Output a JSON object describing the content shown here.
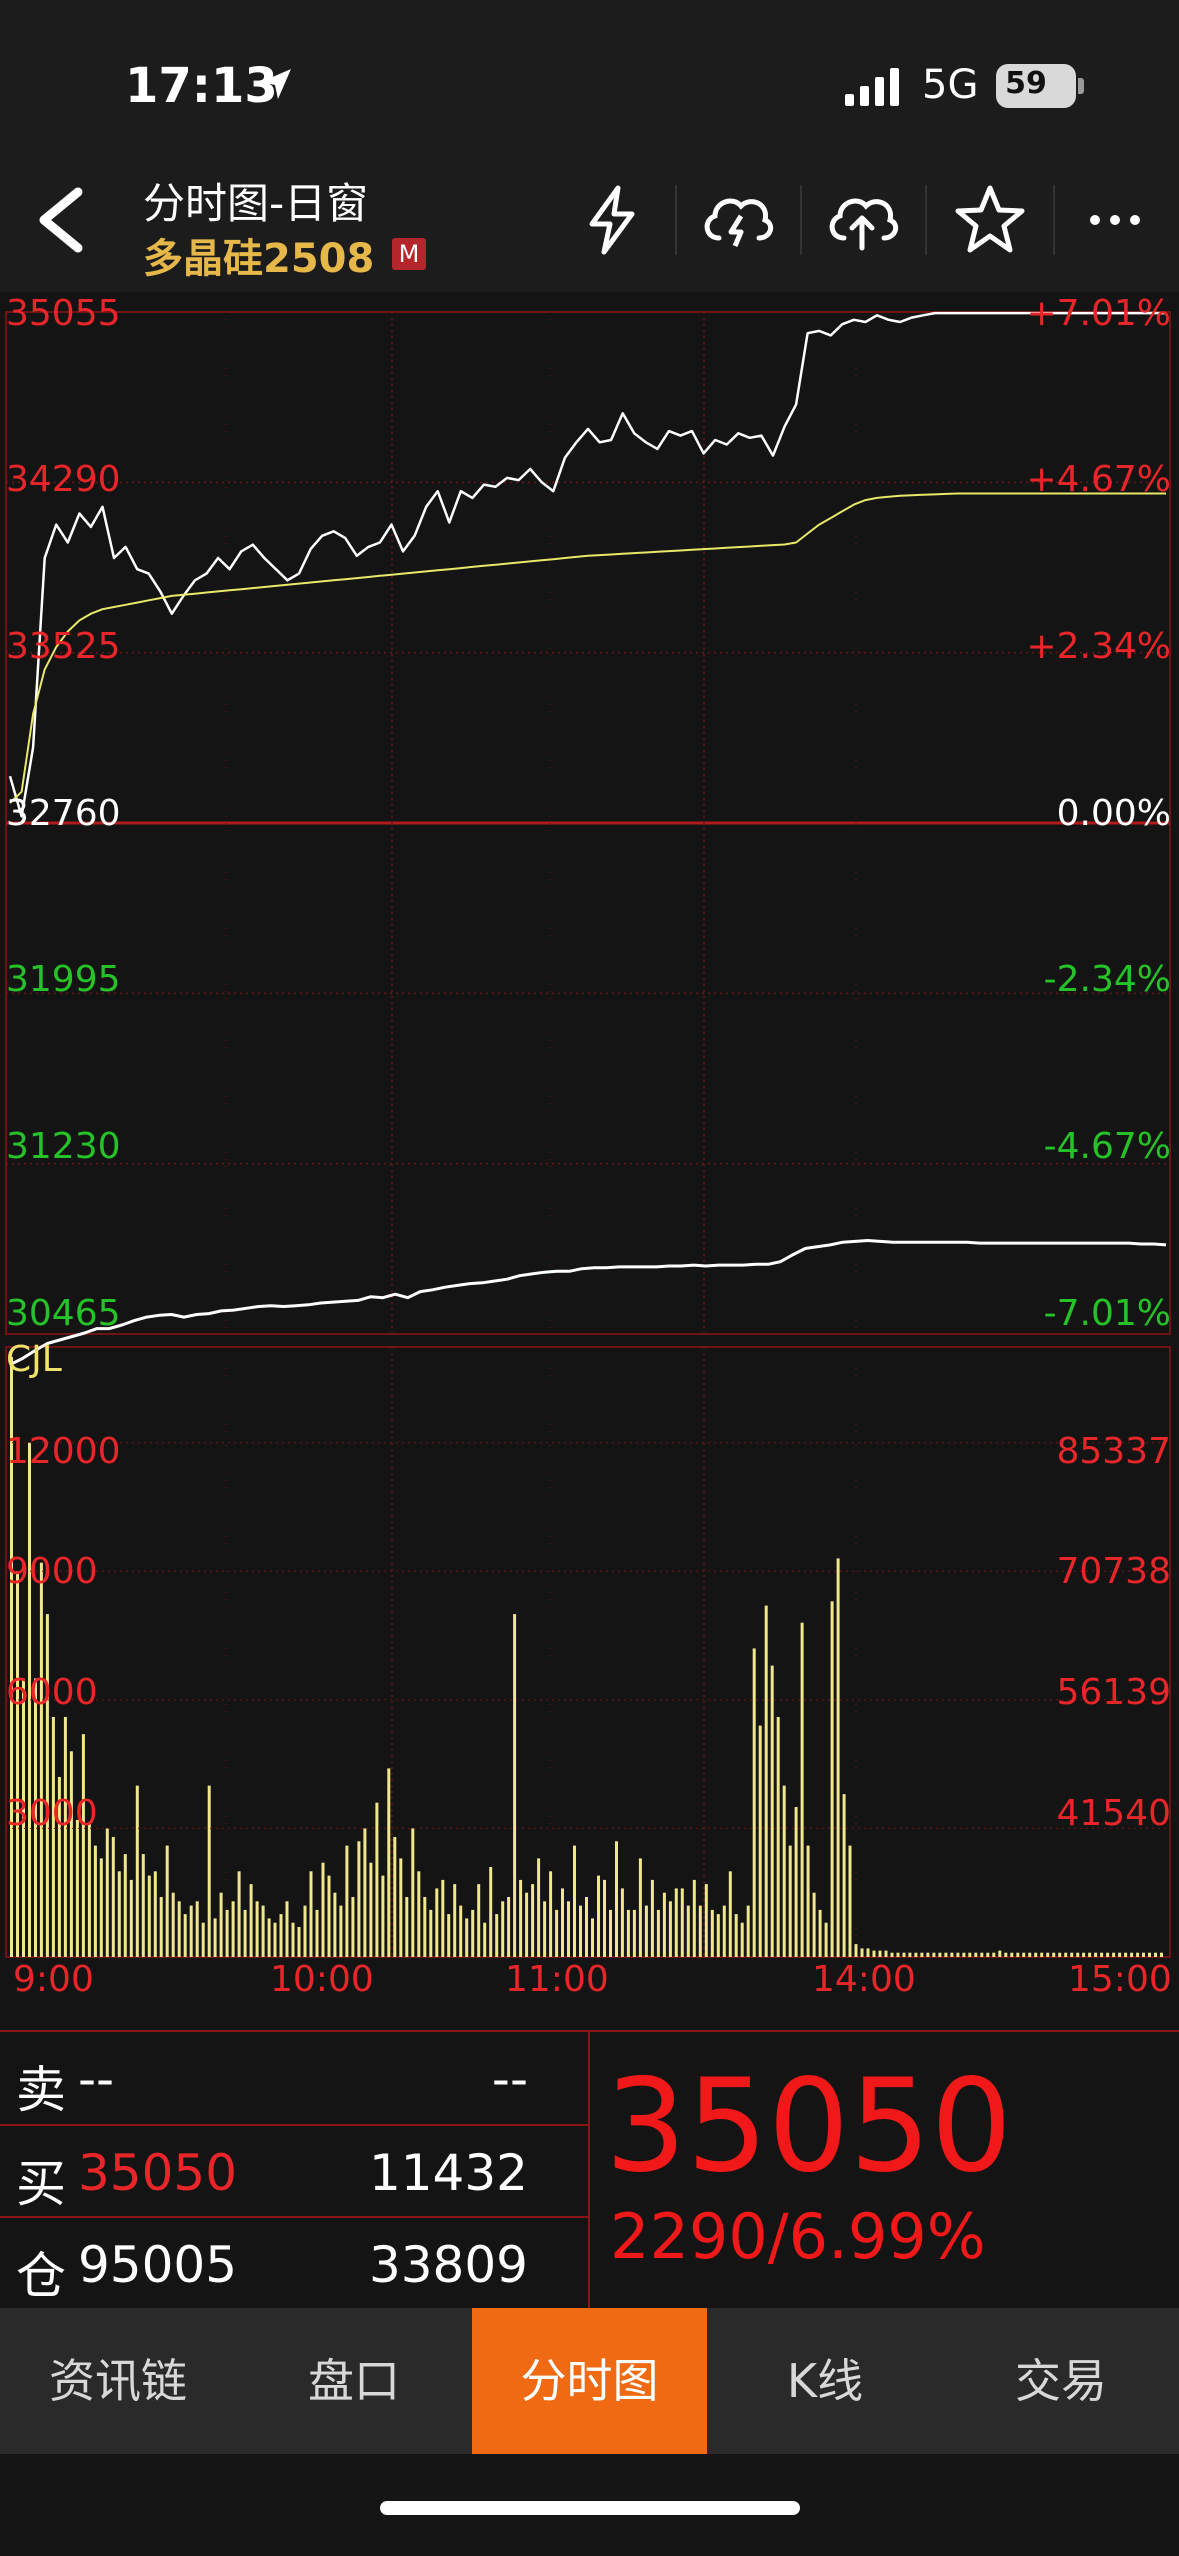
{
  "status_bar": {
    "time": "17:13",
    "network": "5G",
    "battery": "59"
  },
  "header": {
    "title": "分时图-日窗",
    "contract": "多晶硅2508",
    "badge": "M",
    "icons": [
      "back-icon",
      "lightning-icon",
      "cloud-lightning-icon",
      "cloud-upload-icon",
      "star-icon",
      "more-icon"
    ]
  },
  "price_axis": {
    "left": [
      "35055",
      "34290",
      "33525",
      "32760",
      "31995",
      "31230",
      "30465"
    ],
    "right": [
      "+7.01%",
      "+4.67%",
      "+2.34%",
      "0.00%",
      "-2.34%",
      "-4.67%",
      "-7.01%"
    ]
  },
  "volume_axis": {
    "title": "CJL",
    "left": [
      "12000",
      "9000",
      "6000",
      "3000"
    ],
    "right": [
      "85337",
      "70738",
      "56139",
      "41540"
    ]
  },
  "time_axis": [
    "9:00",
    "10:00",
    "11:00",
    "14:00",
    "15:00"
  ],
  "chart_data": [
    {
      "type": "line",
      "title": "",
      "ylim": [
        30465,
        35055
      ],
      "base": 32760,
      "series": [
        {
          "name": "price",
          "color": "#ffffff",
          "values": [
            32970,
            32790,
            33100,
            33950,
            34100,
            34020,
            34150,
            34090,
            34180,
            33950,
            34000,
            33900,
            33880,
            33800,
            33700,
            33780,
            33850,
            33880,
            33950,
            33900,
            33980,
            34010,
            33950,
            33900,
            33850,
            33880,
            33990,
            34050,
            34070,
            34040,
            33960,
            34000,
            34020,
            34100,
            33980,
            34050,
            34180,
            34250,
            34110,
            34250,
            34220,
            34280,
            34270,
            34310,
            34300,
            34350,
            34290,
            34250,
            34400,
            34470,
            34530,
            34470,
            34480,
            34600,
            34510,
            34470,
            34440,
            34520,
            34500,
            34520,
            34420,
            34480,
            34460,
            34510,
            34490,
            34500,
            34410,
            34540,
            34640,
            34960,
            34970,
            34950,
            35000,
            35020,
            35010,
            35040,
            35020,
            35010,
            35030,
            35040,
            35050,
            35050,
            35050,
            35050,
            35050,
            35050,
            35050,
            35050,
            35050,
            35050,
            35050,
            35050,
            35050,
            35050,
            35050,
            35050,
            35050,
            35050,
            35050,
            35050,
            35050
          ]
        },
        {
          "name": "average",
          "color": "#e8e86a",
          "values": [
            32850,
            32900,
            33250,
            33450,
            33550,
            33620,
            33670,
            33700,
            33720,
            33730,
            33740,
            33750,
            33760,
            33770,
            33780,
            33785,
            33790,
            33795,
            33800,
            33805,
            33810,
            33815,
            33820,
            33825,
            33830,
            33835,
            33840,
            33845,
            33850,
            33855,
            33860,
            33865,
            33870,
            33875,
            33880,
            33885,
            33890,
            33895,
            33900,
            33905,
            33910,
            33915,
            33920,
            33925,
            33930,
            33935,
            33940,
            33945,
            33950,
            33955,
            33960,
            33963,
            33966,
            33969,
            33972,
            33975,
            33978,
            33981,
            33984,
            33987,
            33990,
            33993,
            33996,
            33999,
            34002,
            34005,
            34008,
            34011,
            34020,
            34060,
            34100,
            34130,
            34160,
            34190,
            34210,
            34220,
            34225,
            34230,
            34232,
            34234,
            34236,
            34238,
            34240,
            34240,
            34240,
            34240,
            34240,
            34240,
            34240,
            34240,
            34240,
            34240,
            34240,
            34240,
            34240,
            34240,
            34240,
            34240,
            34240,
            34240,
            34240
          ]
        }
      ]
    },
    {
      "type": "bar",
      "title": "CJL",
      "ylim": [
        0,
        14000
      ],
      "series": [
        {
          "name": "volume",
          "color": "#f0e68c",
          "values": [
            14000,
            9000,
            6500,
            12000,
            6500,
            9200,
            8000,
            5600,
            4200,
            5600,
            4800,
            3200,
            5200,
            3100,
            2600,
            2300,
            3000,
            2800,
            2000,
            2400,
            1800,
            4000,
            2400,
            1900,
            2000,
            1400,
            2600,
            1500,
            1300,
            1000,
            1200,
            1300,
            800,
            4000,
            900,
            1500,
            1100,
            1300,
            2000,
            1100,
            1700,
            1300,
            1200,
            900,
            800,
            1000,
            1300,
            800,
            700,
            1200,
            2000,
            1100,
            2200,
            1900,
            1500,
            1200,
            2600,
            1400,
            2700,
            3000,
            2200,
            3600,
            1900,
            4400,
            2800,
            2300,
            1400,
            3000,
            2000,
            1400,
            1100,
            1600,
            1800,
            1000,
            1700,
            1200,
            900,
            1100,
            1700,
            800,
            2100,
            1000,
            1300,
            1400,
            8000,
            1800,
            1500,
            1700,
            2300,
            1300,
            2000,
            1100,
            1600,
            1300,
            2600,
            1200,
            1400,
            900,
            1900,
            1800,
            1100,
            2700,
            1600,
            1100,
            1100,
            2300,
            1200,
            1800,
            1100,
            1500,
            1300,
            1600,
            1600,
            1200,
            1800,
            1200,
            1700,
            1100,
            1000,
            1200,
            2000,
            1000,
            800,
            1200,
            7200,
            5400,
            8200,
            6800,
            5600,
            4000,
            2600,
            3500,
            7800,
            2600,
            1500,
            1100,
            800,
            8300,
            9300,
            3800,
            2600,
            300,
            200,
            200,
            150,
            150,
            150,
            100,
            100,
            100,
            100,
            100,
            100,
            100,
            100,
            100,
            100,
            100,
            100,
            100,
            100,
            100,
            100,
            100,
            100,
            150,
            100,
            100,
            100,
            100,
            100,
            100,
            100,
            100,
            100,
            100,
            100,
            100,
            100,
            100,
            100,
            100,
            100,
            100,
            100,
            100,
            100,
            100,
            100,
            100,
            100,
            100,
            100
          ]
        },
        {
          "name": "open_interest",
          "color": "#ffffff",
          "values": [
            94200,
            94900,
            95800,
            96600,
            97000,
            97400,
            97800,
            98300,
            98300,
            98700,
            99200,
            99600,
            99800,
            99900,
            99600,
            99900,
            100000,
            100300,
            100400,
            100600,
            100800,
            100900,
            100800,
            100900,
            101000,
            101200,
            101300,
            101400,
            101500,
            101900,
            101800,
            102200,
            101800,
            102500,
            102700,
            103000,
            103200,
            103400,
            103500,
            103700,
            103900,
            104300,
            104500,
            104700,
            104800,
            104800,
            105100,
            105200,
            105200,
            105300,
            105300,
            105300,
            105300,
            105400,
            105400,
            105500,
            105400,
            105500,
            105500,
            105500,
            105600,
            105600,
            105900,
            106700,
            107400,
            107600,
            107800,
            108100,
            108200,
            108300,
            108200,
            108100,
            108100,
            108100,
            108100,
            108100,
            108100,
            108100,
            108000,
            108000,
            108000,
            108000,
            108000,
            108000,
            108000,
            108000,
            108000,
            108000,
            108000,
            108000,
            108000,
            107900,
            107900,
            107800
          ]
        }
      ]
    }
  ],
  "quote": {
    "sell_label": "卖",
    "sell_price": "--",
    "sell_vol": "--",
    "buy_label": "买",
    "buy_price": "35050",
    "buy_vol": "11432",
    "oi_label": "仓",
    "oi_value": "95005",
    "oi_change": "33809",
    "last_price": "35050",
    "change": "2290/6.99%"
  },
  "tabs": [
    {
      "label": "资讯链"
    },
    {
      "label": "盘口"
    },
    {
      "label": "分时图"
    },
    {
      "label": "K线"
    },
    {
      "label": "交易"
    }
  ],
  "active_tab": "分时图"
}
